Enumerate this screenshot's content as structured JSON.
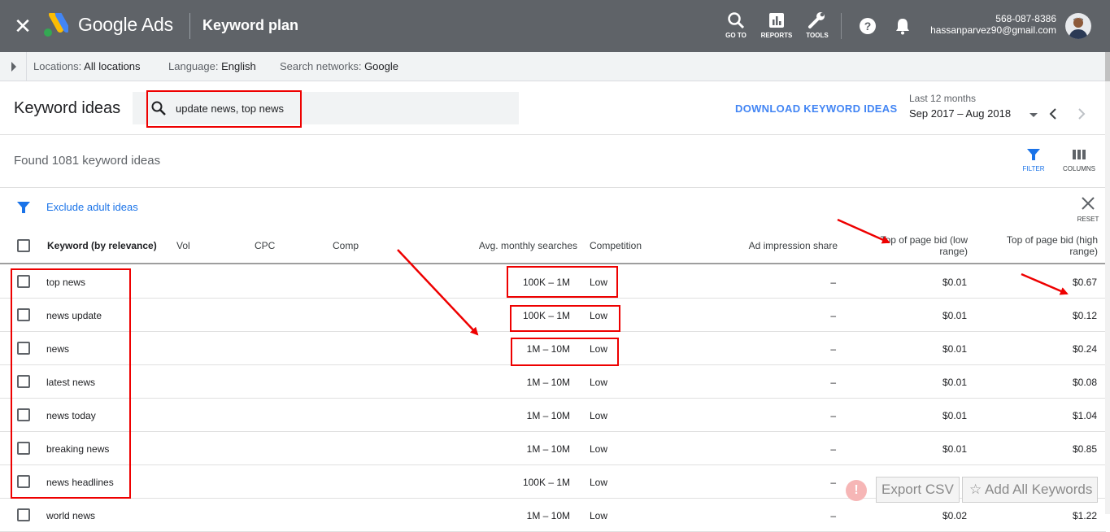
{
  "header": {
    "brand": "Google Ads",
    "page_title": "Keyword plan",
    "tools": [
      {
        "label": "GO TO",
        "icon": "search-icon"
      },
      {
        "label": "REPORTS",
        "icon": "reports-icon"
      },
      {
        "label": "TOOLS",
        "icon": "wrench-icon"
      }
    ],
    "account_id": "568-087-8386",
    "account_email": "hassanparvez90@gmail.com"
  },
  "filters": {
    "locations_label": "Locations:",
    "locations_value": "All locations",
    "language_label": "Language:",
    "language_value": "English",
    "networks_label": "Search networks:",
    "networks_value": "Google"
  },
  "keyword_ideas": {
    "title": "Keyword ideas",
    "search_value": "update news, top news",
    "download_label": "DOWNLOAD KEYWORD IDEAS",
    "date_caption": "Last 12 months",
    "date_value": "Sep 2017 – Aug 2018"
  },
  "toolbar": {
    "found_text": "Found 1081 keyword ideas",
    "filter_label": "FILTER",
    "columns_label": "COLUMNS",
    "exclude_label": "Exclude adult ideas",
    "reset_label": "RESET"
  },
  "table": {
    "headers": {
      "keyword": "Keyword (by relevance)",
      "vol": "Vol",
      "cpc": "CPC",
      "comp": "Comp",
      "avg": "Avg. monthly searches",
      "competition": "Competition",
      "impression": "Ad impression share",
      "bid_low": "Top of page bid (low range)",
      "bid_high": "Top of page bid (high range)"
    },
    "rows": [
      {
        "keyword": "top news",
        "avg": "100K – 1M",
        "competition": "Low",
        "impression": "–",
        "bid_low": "$0.01",
        "bid_high": "$0.67"
      },
      {
        "keyword": "news update",
        "avg": "100K – 1M",
        "competition": "Low",
        "impression": "–",
        "bid_low": "$0.01",
        "bid_high": "$0.12"
      },
      {
        "keyword": "news",
        "avg": "1M – 10M",
        "competition": "Low",
        "impression": "–",
        "bid_low": "$0.01",
        "bid_high": "$0.24"
      },
      {
        "keyword": "latest news",
        "avg": "1M – 10M",
        "competition": "Low",
        "impression": "–",
        "bid_low": "$0.01",
        "bid_high": "$0.08"
      },
      {
        "keyword": "news today",
        "avg": "1M – 10M",
        "competition": "Low",
        "impression": "–",
        "bid_low": "$0.01",
        "bid_high": "$1.04"
      },
      {
        "keyword": "breaking news",
        "avg": "1M – 10M",
        "competition": "Low",
        "impression": "–",
        "bid_low": "$0.01",
        "bid_high": "$0.85"
      },
      {
        "keyword": "news headlines",
        "avg": "100K – 1M",
        "competition": "Low",
        "impression": "–",
        "bid_low": "",
        "bid_high": ""
      },
      {
        "keyword": "world news",
        "avg": "1M – 10M",
        "competition": "Low",
        "impression": "–",
        "bid_low": "$0.02",
        "bid_high": "$1.22"
      }
    ]
  },
  "extension": {
    "export_label": "Export CSV",
    "add_all_label": "Add All Keywords",
    "warning_glyph": "!"
  },
  "annotation_color": "#e00000",
  "accent_color": "#1a73e8"
}
